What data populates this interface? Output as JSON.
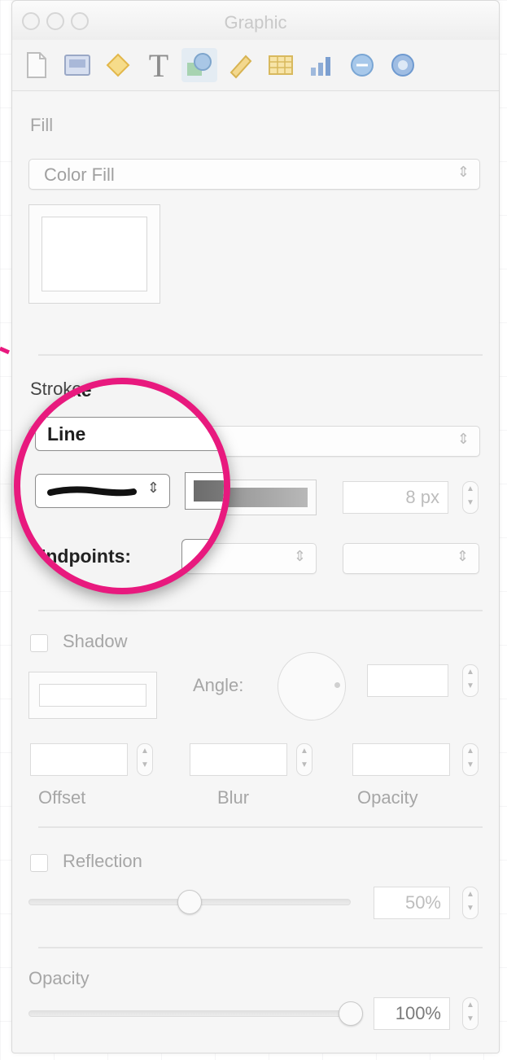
{
  "window": {
    "title": "Graphic"
  },
  "toolbar": {
    "tools": [
      {
        "name": "document-icon"
      },
      {
        "name": "slide-icon"
      },
      {
        "name": "metrics-icon"
      },
      {
        "name": "text-icon",
        "glyph": "T"
      },
      {
        "name": "graphic-icon"
      },
      {
        "name": "ruler-icon"
      },
      {
        "name": "table-icon"
      },
      {
        "name": "chart-icon"
      },
      {
        "name": "link-icon"
      },
      {
        "name": "quicktime-icon"
      }
    ]
  },
  "fill": {
    "heading": "Fill",
    "type_value": "Color Fill"
  },
  "stroke": {
    "heading": "Stroke",
    "type_value": "Line",
    "width_value": "8 px",
    "endpoints_label": "Endpoints:"
  },
  "shadow": {
    "label": "Shadow",
    "angle_label": "Angle:",
    "offset_label": "Offset",
    "blur_label": "Blur",
    "opacity_label": "Opacity"
  },
  "reflection": {
    "label": "Reflection",
    "value": "50%",
    "level": 0.5
  },
  "opacity": {
    "heading": "Opacity",
    "value": "100%",
    "level": 1.0
  },
  "colors": {
    "highlight": "#e8197e",
    "active_tool": "#e4ecf3"
  }
}
